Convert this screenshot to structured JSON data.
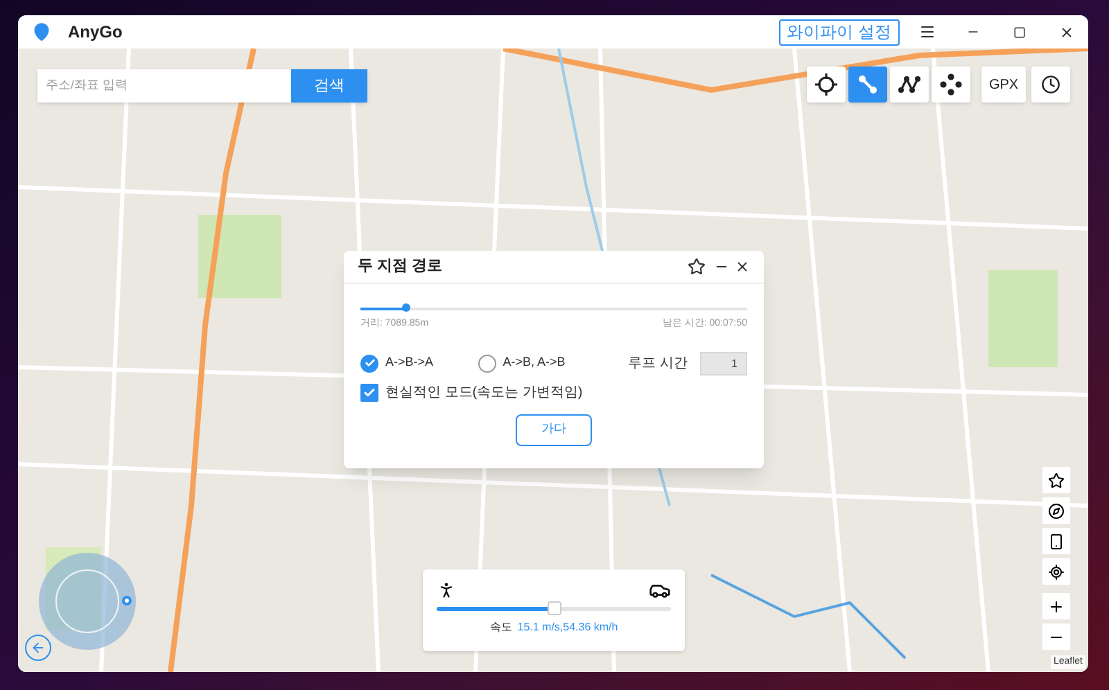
{
  "window": {
    "title": "AnyGo",
    "wifi_button": "와이파이 설정"
  },
  "search": {
    "placeholder": "주소/좌표 입력",
    "button": "검색"
  },
  "mode_buttons": [
    {
      "kind": "teleport",
      "selected": false
    },
    {
      "kind": "two-spot",
      "selected": true
    },
    {
      "kind": "multi-spot",
      "selected": false
    },
    {
      "kind": "joystick",
      "selected": false
    }
  ],
  "gpx_button": "GPX",
  "dialog": {
    "title": "두 지점 경로",
    "progress": {
      "level": 0.12
    },
    "distance": "거리: 7089.85m",
    "remaining": "남은 시간: 00:07:50",
    "route_options": [
      {
        "label": "A->B->A",
        "selected": true
      },
      {
        "label": "A->B, A->B",
        "selected": false
      }
    ],
    "loop_label": "루프 시간",
    "loop_value": "1",
    "realistic_mode": {
      "label": "현실적인 모드(속도는 가변적임)",
      "checked": true
    },
    "go_button": "가다"
  },
  "speed": {
    "level": 0.5,
    "label": "속도",
    "value": "15.1 m/s,54.36 km/h"
  },
  "attribution": "Leaflet"
}
